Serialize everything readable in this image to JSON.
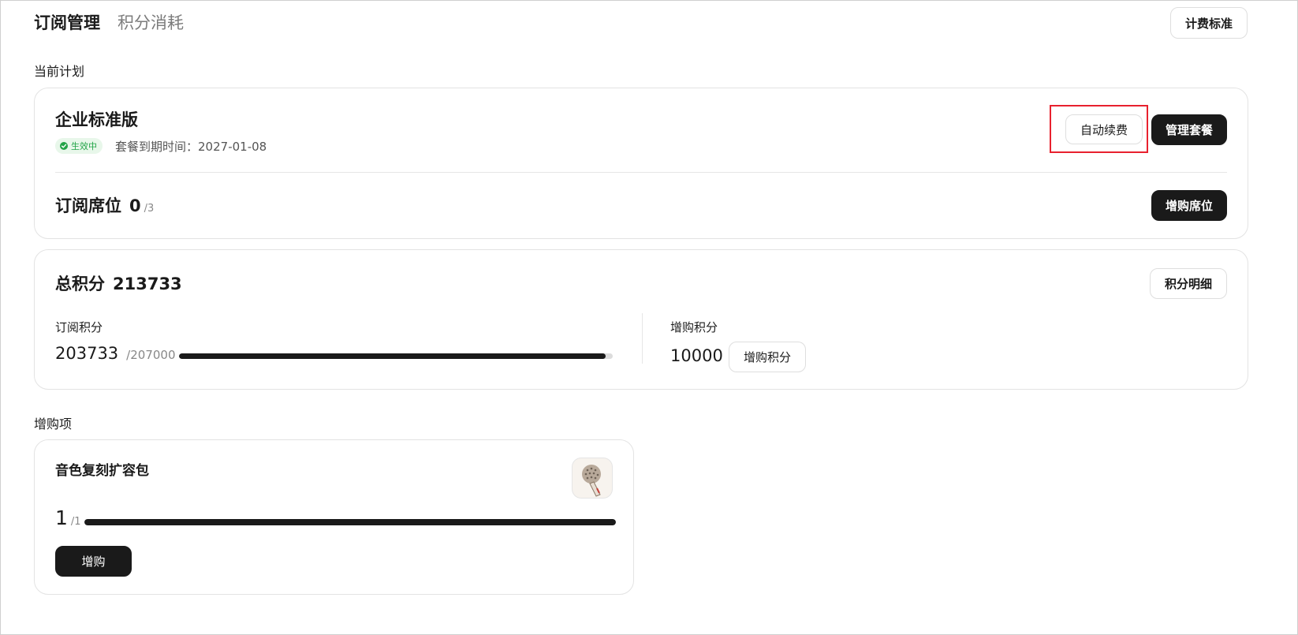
{
  "header": {
    "tabs": [
      {
        "label": "订阅管理",
        "active": true
      },
      {
        "label": "积分消耗",
        "active": false
      }
    ],
    "pricing_button": "计费标准"
  },
  "current_plan": {
    "section_title": "当前计划",
    "plan_name": "企业标准版",
    "status_badge": "生效中",
    "expire_label": "套餐到期时间：",
    "expire_date": "2027-01-08",
    "auto_renew_button": "自动续费",
    "manage_button": "管理套餐",
    "seats": {
      "label": "订阅席位",
      "used": "0",
      "total": "/3",
      "buy_button": "增购席位"
    }
  },
  "credits": {
    "title": "总积分",
    "total": "213733",
    "detail_button": "积分明细",
    "subscription": {
      "label": "订阅积分",
      "value": "203733",
      "max": "/207000",
      "progress_fraction": 0.984
    },
    "purchased": {
      "label": "增购积分",
      "value": "10000",
      "buy_button": "增购积分"
    }
  },
  "addons": {
    "section_title": "增购项",
    "items": [
      {
        "name": "音色复刻扩容包",
        "icon": "microphone-icon",
        "used": "1",
        "total": "/1",
        "progress_fraction": 1.0,
        "buy_button": "增购"
      }
    ]
  },
  "colors": {
    "accent_dark": "#1a1a1a",
    "status_green": "#22a447",
    "highlight_red": "#e8212e"
  }
}
